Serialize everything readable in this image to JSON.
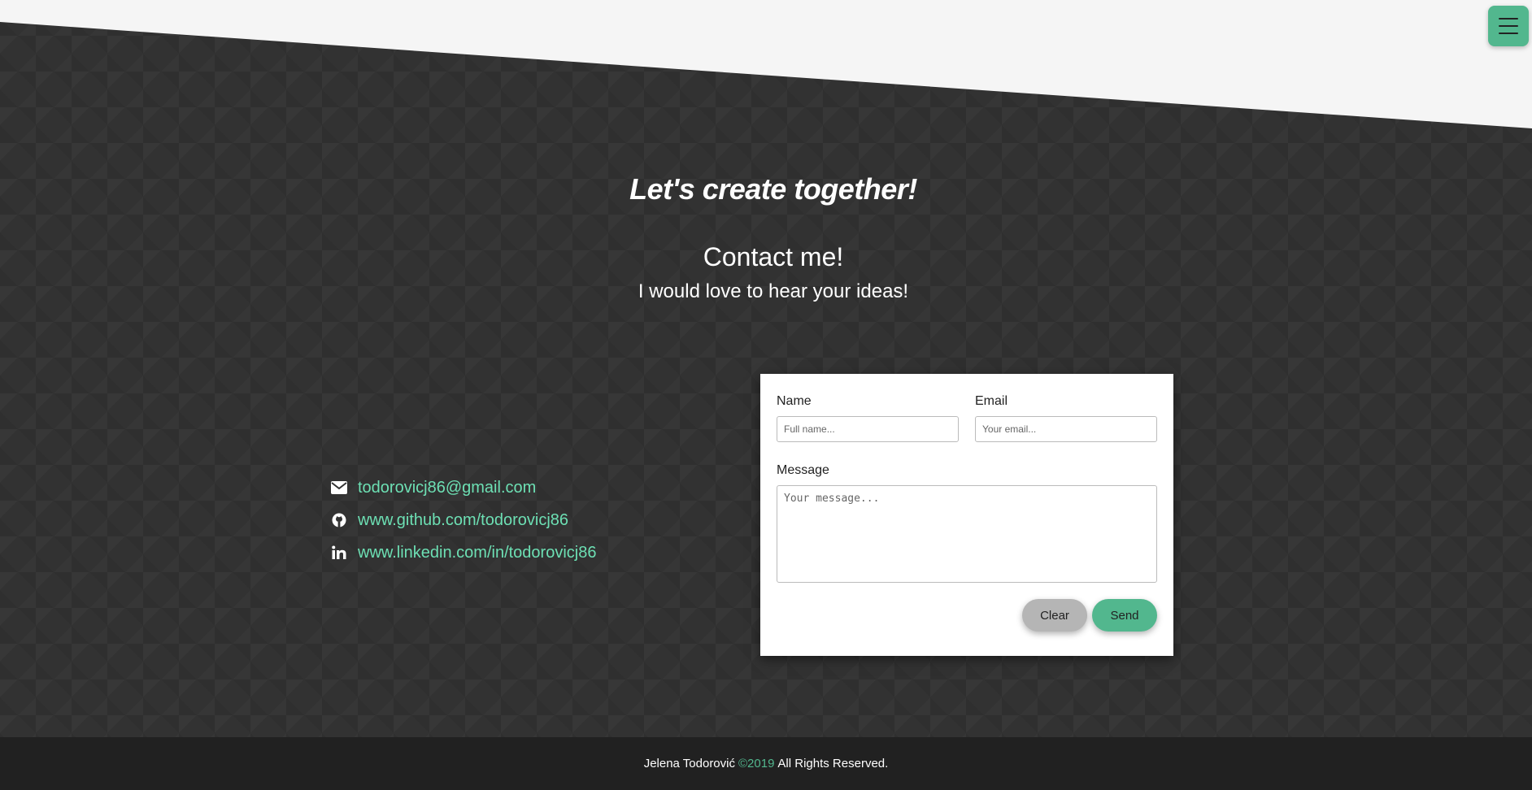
{
  "menu": {
    "icon": "hamburger-menu-icon"
  },
  "hero": {
    "tagline": "Let's create together!",
    "title": "Contact me!",
    "subtitle": "I would love to hear your ideas!"
  },
  "links": [
    {
      "icon": "envelope-icon",
      "text": "todorovicj86@gmail.com"
    },
    {
      "icon": "github-icon",
      "text": "www.github.com/todorovicj86"
    },
    {
      "icon": "linkedin-icon",
      "text": "www.linkedin.com/in/todorovicj86"
    }
  ],
  "form": {
    "name_label": "Name",
    "name_placeholder": "Full name...",
    "email_label": "Email",
    "email_placeholder": "Your email...",
    "message_label": "Message",
    "message_placeholder": "Your message...",
    "clear_label": "Clear",
    "send_label": "Send"
  },
  "footer": {
    "name": "Jelena Todorović",
    "year": "©2019",
    "rights": "All Rights Reserved."
  },
  "colors": {
    "accent": "#52b78e",
    "link": "#6de0b4",
    "background": "#323232",
    "footer": "#212121",
    "top": "#f5f5f5"
  }
}
